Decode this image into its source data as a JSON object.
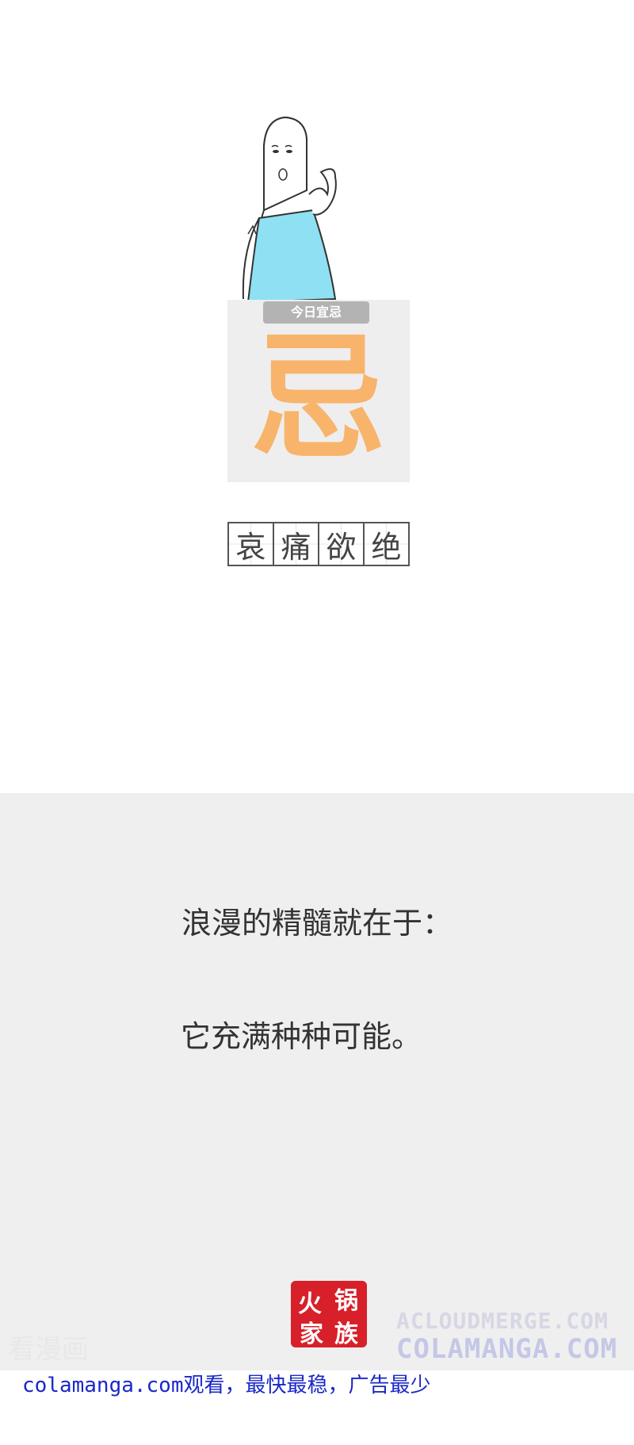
{
  "card": {
    "tag": "今日宜忌",
    "glyph": "忌"
  },
  "idiom": [
    "哀",
    "痛",
    "欲",
    "绝"
  ],
  "panel": {
    "line1": "浪漫的精髓就在于：",
    "line2": "它充满种种可能。"
  },
  "seal": {
    "text": "火锅家族",
    "color": "#d8202a"
  },
  "watermarks": {
    "left": "看漫画",
    "right_top": "ACLOUDMERGE.COM",
    "right_bottom": "COLAMANGA.COM"
  },
  "ad": {
    "text": "colamanga.com观看，最快最稳，广告最少"
  },
  "colors": {
    "shirt": "#8fe0f2",
    "glyph": "#f8b46b",
    "panel": "#efefef",
    "ad_text": "#1a28c8"
  }
}
